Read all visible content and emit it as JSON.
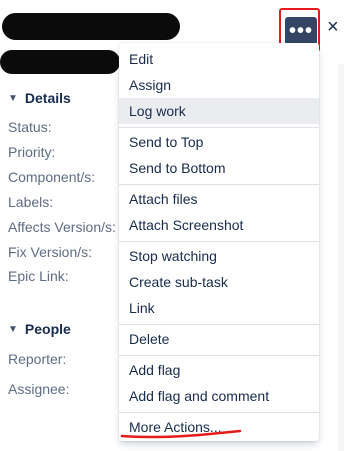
{
  "toolbar": {
    "more_label": "•••",
    "close_label": "×"
  },
  "details": {
    "title": "Details",
    "fields": [
      "Status:",
      "Priority:",
      "Component/s:",
      "Labels:",
      "Affects Version/s:",
      "Fix Version/s:",
      "Epic Link:"
    ]
  },
  "people": {
    "title": "People",
    "fields": [
      "Reporter:",
      "Assignee:"
    ]
  },
  "menu": {
    "items": [
      "Edit",
      "Assign",
      "Log work",
      "Send to Top",
      "Send to Bottom",
      "Attach files",
      "Attach Screenshot",
      "Stop watching",
      "Create sub-task",
      "Link",
      "Delete",
      "Add flag",
      "Add flag and comment",
      "More Actions..."
    ],
    "highlighted_item": "Log work"
  },
  "colors": {
    "more_button_bg": "#344563",
    "annotation_red": "#e51b1b",
    "menu_highlight": "#ebecf0"
  }
}
